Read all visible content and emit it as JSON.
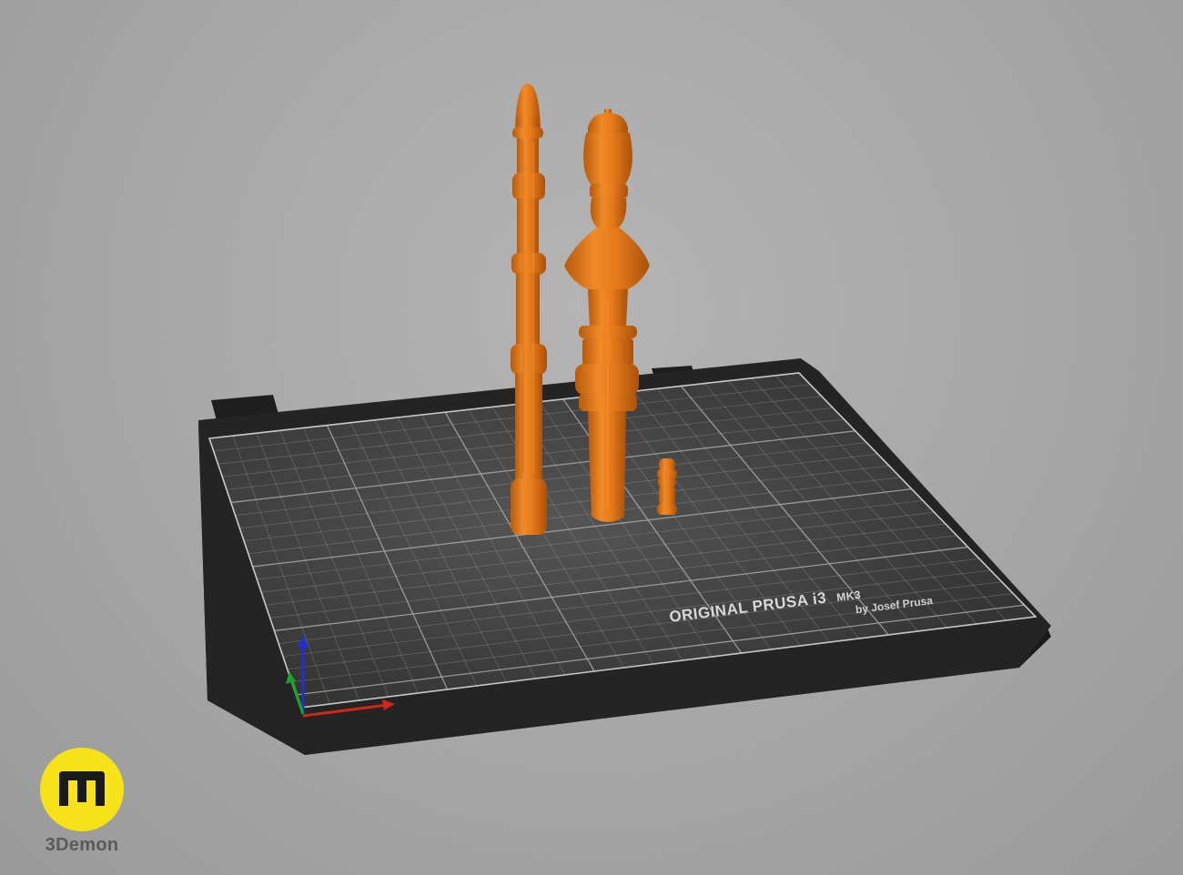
{
  "viewport": {
    "background_color": "#a9a9a9",
    "scene": "3D print bed preview"
  },
  "bed": {
    "brand_line": "ORIGINAL PRUSA i3",
    "model_line": "MK3",
    "byline": "by Josef Prusa",
    "surface_color": "#3a3a3a",
    "frame_color": "#1f1f1f",
    "grid_color": "#9a9a9a"
  },
  "objects": [
    {
      "name": "tall-ringed-rod",
      "color": "#e77a1c"
    },
    {
      "name": "turned-column",
      "color": "#e77a1c"
    },
    {
      "name": "small-peg",
      "color": "#e77a1c"
    }
  ],
  "axes": {
    "x_color": "#d0261c",
    "y_color": "#1aa32a",
    "z_color": "#1e2fd6"
  },
  "watermark": {
    "icon": "m-letter-icon",
    "text": "3Demon",
    "badge_color": "#f7e21a"
  }
}
